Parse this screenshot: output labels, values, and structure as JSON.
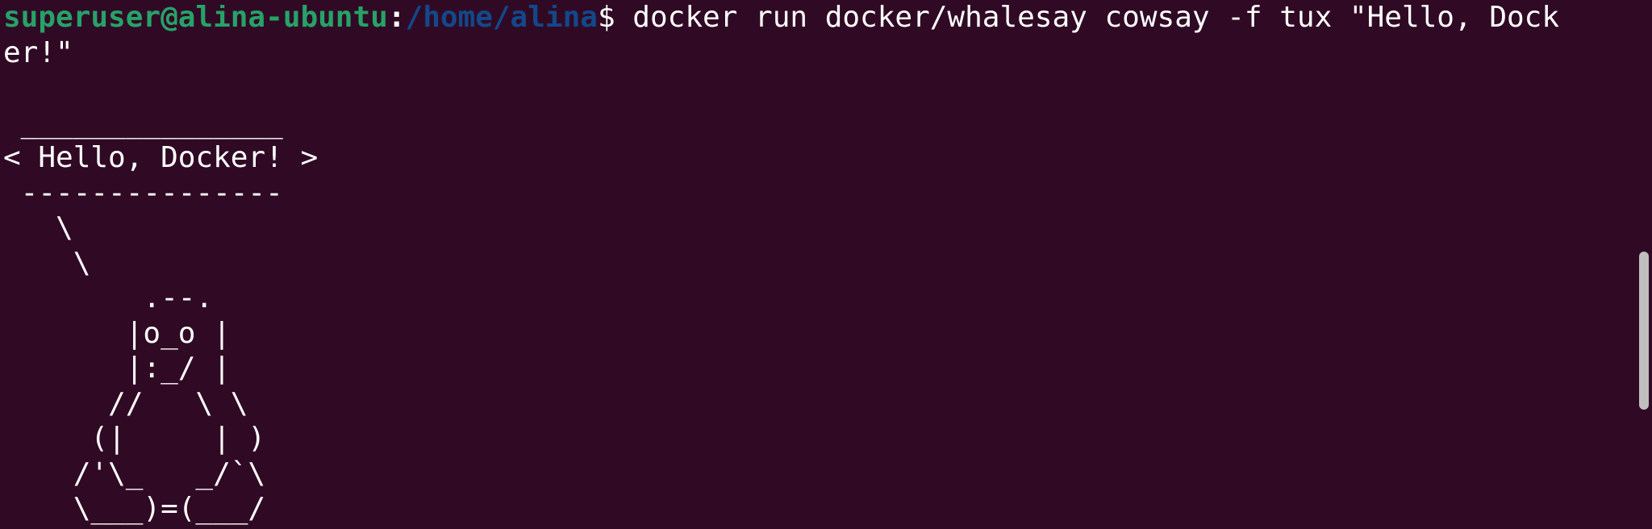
{
  "prompt": {
    "user_host": "superuser@alina-ubuntu",
    "separator": ":",
    "path": "/home/alina",
    "symbol": "$"
  },
  "command": {
    "line1": " docker run docker/whalesay cowsay -f tux \"Hello, Dock",
    "line2": "er!\""
  },
  "output": {
    "bubble_top": " _______________",
    "bubble_text": "< Hello, Docker! >",
    "bubble_bottom": " ---------------",
    "tux_lines": [
      "   \\",
      "    \\",
      "        .--.",
      "       |o_o |",
      "       |:_/ |",
      "      //   \\ \\",
      "     (|     | )",
      "    /'\\_   _/`\\",
      "    \\___)=(___/"
    ]
  },
  "colors": {
    "background": "#300a24",
    "prompt_user": "#26a269",
    "prompt_path": "#12488b",
    "text": "#ffffff",
    "scrollbar": "#bfbfbf"
  }
}
